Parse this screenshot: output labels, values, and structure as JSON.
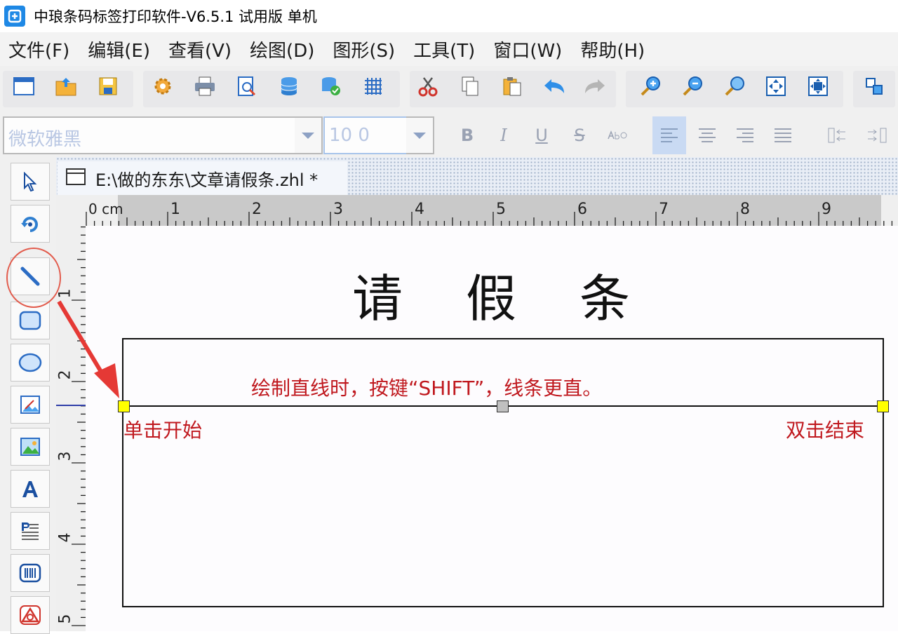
{
  "window": {
    "title": "中琅条码标签打印软件-V6.5.1 试用版 单机"
  },
  "menu": [
    "文件(F)",
    "编辑(E)",
    "查看(V)",
    "绘图(D)",
    "图形(S)",
    "工具(T)",
    "窗口(W)",
    "帮助(H)"
  ],
  "format_bar": {
    "font_placeholder": "微软雅黑",
    "size_placeholder": "10 0",
    "bold": "B",
    "italic": "I",
    "underline": "U",
    "strike": "S"
  },
  "document": {
    "tab_title": "E:\\做的东东\\文章请假条.zhl *"
  },
  "ruler": {
    "unit": "0 cm",
    "h_ticks": [
      "1",
      "2",
      "3",
      "4",
      "5",
      "6",
      "7",
      "8",
      "9"
    ],
    "v_ticks": [
      "1",
      "2",
      "3",
      "4",
      "5"
    ]
  },
  "canvas": {
    "label_title": "请假条",
    "instruction": "绘制直线时，按键“SHIFT”，线条更直。",
    "start_hint": "单击开始",
    "end_hint": "双击结束"
  },
  "colors": {
    "accent": "#c0191f",
    "handle_end": "#ffff00",
    "handle_mid": "#c0c0c0",
    "selected_tool_circle": "#e25b4c"
  }
}
